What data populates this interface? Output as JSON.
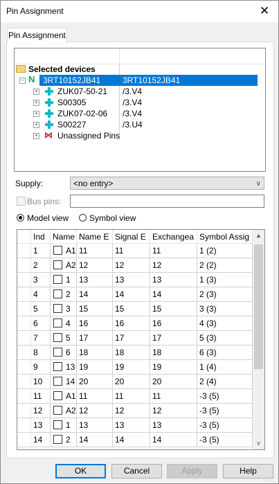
{
  "window": {
    "title": "Pin Assignment"
  },
  "tab": {
    "label": "Pin Assignment"
  },
  "tree": {
    "root_label": "Selected devices",
    "items": [
      {
        "name": "3RT10152JB41",
        "value": "3RT10152JB41",
        "selected": true,
        "icon": "device-icon"
      },
      {
        "name": "ZUK07-50-21",
        "value": "/3.V4",
        "icon": "terminal-icon"
      },
      {
        "name": "S00305",
        "value": "/3.V4",
        "icon": "terminal-icon"
      },
      {
        "name": "ZUK07-02-06",
        "value": "/3.V4",
        "icon": "terminal-icon"
      },
      {
        "name": "S00227",
        "value": "/3.U4",
        "icon": "terminal-icon"
      },
      {
        "name": "Unassigned Pins",
        "value": "",
        "icon": "unassigned-pins-icon"
      }
    ]
  },
  "supply": {
    "label": "Supply:",
    "value": "<no entry>"
  },
  "bus_pins": {
    "label": "Bus pins:",
    "value": ""
  },
  "view": {
    "model_label": "Model view",
    "symbol_label": "Symbol view",
    "selected": "model"
  },
  "table": {
    "columns": [
      "Ind",
      "Name",
      "Name E",
      "Signal E",
      "Exchangea",
      "Symbol Assig"
    ],
    "rows": [
      {
        "ind": "1",
        "name": "A1",
        "name_e": "11",
        "signal_e": "11",
        "exch": "11",
        "symbol": "1 (2)"
      },
      {
        "ind": "2",
        "name": "A2",
        "name_e": "12",
        "signal_e": "12",
        "exch": "12",
        "symbol": "2 (2)"
      },
      {
        "ind": "3",
        "name": "1",
        "name_e": "13",
        "signal_e": "13",
        "exch": "13",
        "symbol": "1 (3)"
      },
      {
        "ind": "4",
        "name": "2",
        "name_e": "14",
        "signal_e": "14",
        "exch": "14",
        "symbol": "2 (3)"
      },
      {
        "ind": "5",
        "name": "3",
        "name_e": "15",
        "signal_e": "15",
        "exch": "15",
        "symbol": "3 (3)"
      },
      {
        "ind": "6",
        "name": "4",
        "name_e": "16",
        "signal_e": "16",
        "exch": "16",
        "symbol": "4 (3)"
      },
      {
        "ind": "7",
        "name": "5",
        "name_e": "17",
        "signal_e": "17",
        "exch": "17",
        "symbol": "5 (3)"
      },
      {
        "ind": "8",
        "name": "6",
        "name_e": "18",
        "signal_e": "18",
        "exch": "18",
        "symbol": "6 (3)"
      },
      {
        "ind": "9",
        "name": "13",
        "name_e": "19",
        "signal_e": "19",
        "exch": "19",
        "symbol": "1 (4)"
      },
      {
        "ind": "10",
        "name": "14",
        "name_e": "20",
        "signal_e": "20",
        "exch": "20",
        "symbol": "2 (4)"
      },
      {
        "ind": "11",
        "name": "A1",
        "name_e": "11",
        "signal_e": "11",
        "exch": "11",
        "symbol": "-3 (5)"
      },
      {
        "ind": "12",
        "name": "A2",
        "name_e": "12",
        "signal_e": "12",
        "exch": "12",
        "symbol": "-3 (5)"
      },
      {
        "ind": "13",
        "name": "1",
        "name_e": "13",
        "signal_e": "13",
        "exch": "13",
        "symbol": "-3 (5)"
      },
      {
        "ind": "14",
        "name": "2",
        "name_e": "14",
        "signal_e": "14",
        "exch": "14",
        "symbol": "-3 (5)"
      }
    ]
  },
  "buttons": {
    "ok": "OK",
    "cancel": "Cancel",
    "apply": "Apply",
    "help": "Help"
  },
  "colors": {
    "selection": "#0078d7",
    "device_icon": "#1aa24a",
    "terminal_icon": "#0fb8c8",
    "unassigned_icon": "#cc1f2d"
  }
}
